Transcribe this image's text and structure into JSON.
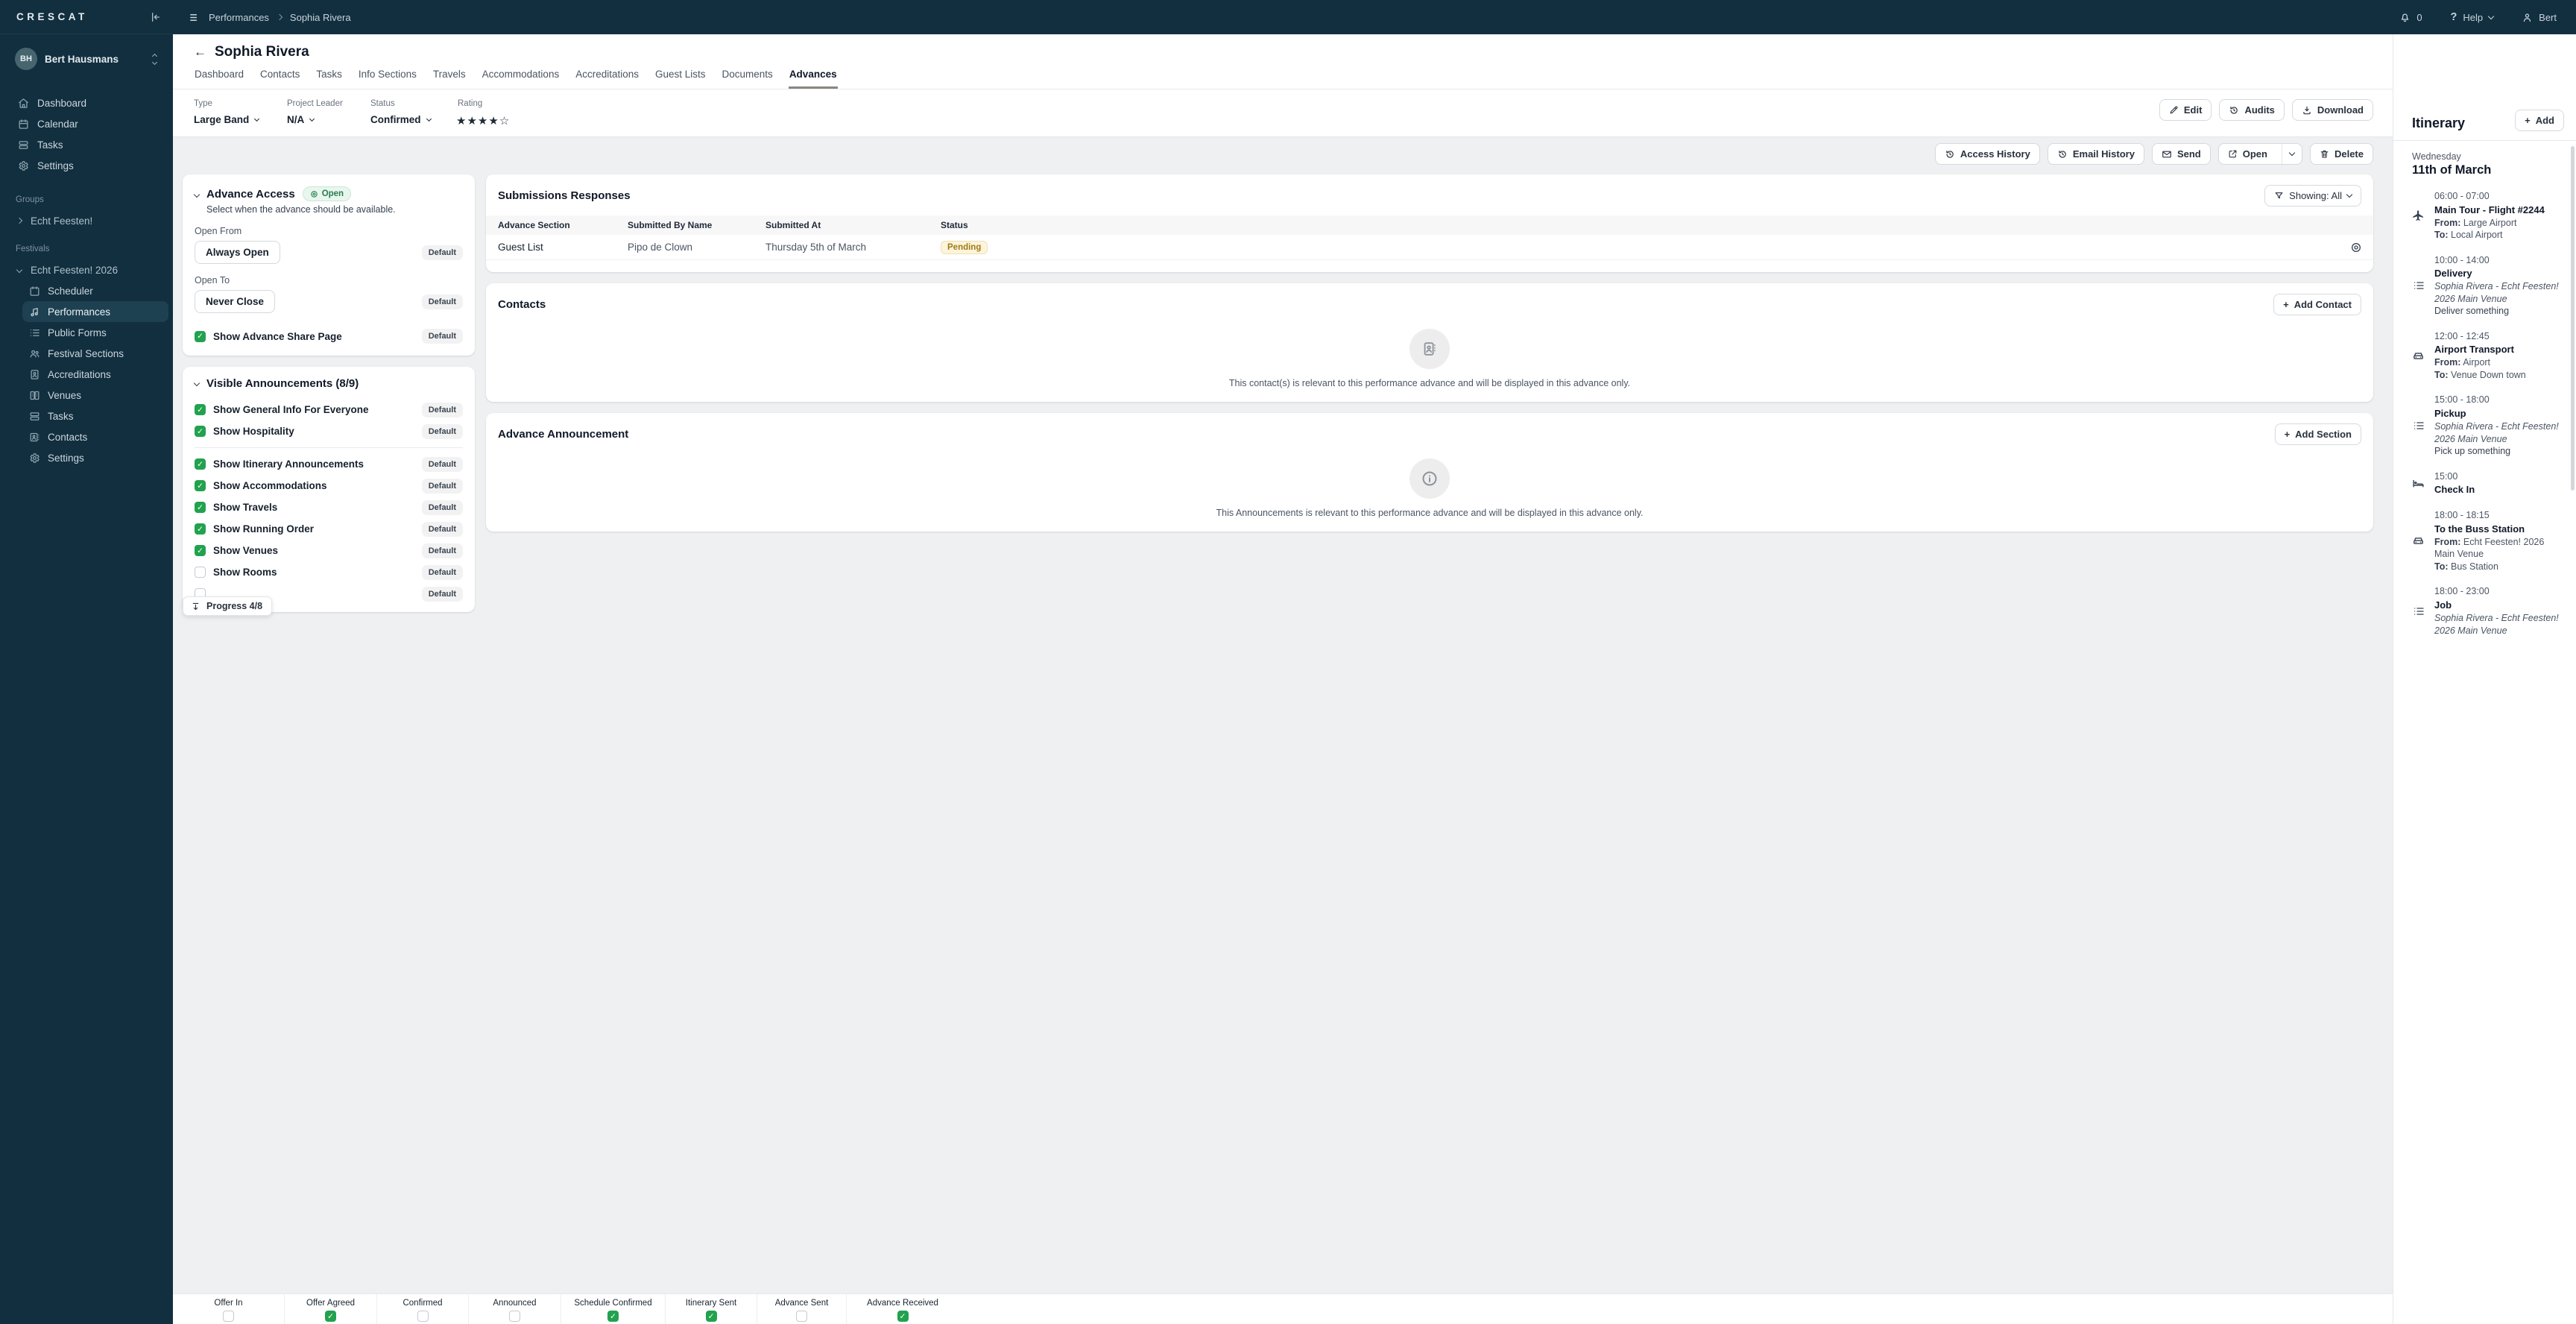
{
  "brand": {
    "logo": "CRESCAT"
  },
  "topbar": {
    "breadcrumb": {
      "section": "Performances",
      "current": "Sophia Rivera"
    },
    "notification_count": "0",
    "help_label": "Help",
    "user_label": "Bert"
  },
  "sidebar": {
    "user": {
      "initials": "BH",
      "name": "Bert Hausmans"
    },
    "nav": [
      {
        "label": "Dashboard",
        "icon": "home-icon"
      },
      {
        "label": "Calendar",
        "icon": "calendar-icon"
      },
      {
        "label": "Tasks",
        "icon": "tasks-icon"
      },
      {
        "label": "Settings",
        "icon": "gear-icon"
      }
    ],
    "groups_label": "Groups",
    "group_item": "Echt Feesten!",
    "festivals_label": "Festivals",
    "festival_item": "Echt Feesten! 2026",
    "festival_nav": [
      {
        "label": "Scheduler",
        "icon": "calendar-icon",
        "active": false
      },
      {
        "label": "Performances",
        "icon": "music-note-icon",
        "active": true
      },
      {
        "label": "Public Forms",
        "icon": "list-icon",
        "active": false
      },
      {
        "label": "Festival Sections",
        "icon": "users-icon",
        "active": false
      },
      {
        "label": "Accreditations",
        "icon": "id-card-icon",
        "active": false
      },
      {
        "label": "Venues",
        "icon": "venues-icon",
        "active": false
      },
      {
        "label": "Tasks",
        "icon": "tasks-icon",
        "active": false
      },
      {
        "label": "Contacts",
        "icon": "contact-card-icon",
        "active": false
      },
      {
        "label": "Settings",
        "icon": "gear-icon",
        "active": false
      }
    ]
  },
  "page": {
    "title": "Sophia Rivera",
    "tabs": [
      "Dashboard",
      "Contacts",
      "Tasks",
      "Info Sections",
      "Travels",
      "Accommodations",
      "Accreditations",
      "Guest Lists",
      "Documents",
      "Advances"
    ],
    "active_tab": "Advances"
  },
  "meta": {
    "type": {
      "label": "Type",
      "value": "Large Band"
    },
    "project_leader": {
      "label": "Project Leader",
      "value": "N/A"
    },
    "status": {
      "label": "Status",
      "value": "Confirmed"
    },
    "rating": {
      "label": "Rating",
      "stars_filled": 4,
      "stars_total": 5
    }
  },
  "header_actions": {
    "edit": "Edit",
    "audits": "Audits",
    "download": "Download"
  },
  "toolbar": {
    "access_history": "Access History",
    "email_history": "Email History",
    "send": "Send",
    "open": "Open",
    "delete": "Delete"
  },
  "advance_access": {
    "title": "Advance Access",
    "badge": "Open",
    "description": "Select when the advance should be available.",
    "open_from_label": "Open From",
    "open_from_value": "Always Open",
    "open_to_label": "Open To",
    "open_to_value": "Never Close",
    "share_label": "Show Advance Share Page",
    "share_checked": true,
    "default_badge": "Default"
  },
  "announcements": {
    "title": "Visible Announcements (8/9)",
    "default_badge": "Default",
    "items": [
      {
        "label": "Show General Info For Everyone",
        "checked": true
      },
      {
        "label": "Show Hospitality",
        "checked": true
      },
      {
        "label": "Show Itinerary Announcements",
        "checked": true
      },
      {
        "label": "Show Accommodations",
        "checked": true
      },
      {
        "label": "Show Travels",
        "checked": true
      },
      {
        "label": "Show Running Order",
        "checked": true
      },
      {
        "label": "Show Venues",
        "checked": true
      },
      {
        "label": "Show Rooms",
        "checked": false
      }
    ]
  },
  "submissions": {
    "title": "Submissions Responses",
    "filter_label": "Showing: All",
    "columns": [
      "Advance Section",
      "Submitted By Name",
      "Submitted At",
      "Status"
    ],
    "rows": [
      {
        "section": "Guest List",
        "submitted_by": "Pipo de Clown",
        "submitted_at": "Thursday 5th of March",
        "status": "Pending"
      }
    ]
  },
  "contacts_card": {
    "title": "Contacts",
    "add_label": "Add Contact",
    "empty_text": "This contact(s) is relevant to this performance advance and will be displayed in this advance only."
  },
  "announcement_card": {
    "title": "Advance Announcement",
    "add_label": "Add Section",
    "empty_text": "This Announcements is relevant to this performance advance and will be displayed in this advance only."
  },
  "itinerary": {
    "title": "Itinerary",
    "add_label": "Add",
    "day_weekday": "Wednesday",
    "day_date": "11th of March",
    "from_label": "From:",
    "to_label": "To:",
    "events": [
      {
        "time": "06:00 - 07:00",
        "icon": "plane-icon",
        "title": "Main Tour - Flight #2244",
        "from": "Large Airport",
        "to": "Local Airport"
      },
      {
        "time": "10:00 - 14:00",
        "icon": "list-icon",
        "title": "Delivery",
        "venue": "Sophia Rivera - Echt Feesten! 2026 Main Venue",
        "note": "Deliver something"
      },
      {
        "time": "12:00 - 12:45",
        "icon": "car-icon",
        "title": "Airport Transport",
        "from": "Airport",
        "to": "Venue Down town"
      },
      {
        "time": "15:00 - 18:00",
        "icon": "list-icon",
        "title": "Pickup",
        "venue": "Sophia Rivera - Echt Feesten! 2026 Main Venue",
        "note": "Pick up something"
      },
      {
        "time": "15:00",
        "icon": "bed-icon",
        "title": "Check In"
      },
      {
        "time": "18:00 - 18:15",
        "icon": "car-icon",
        "title": "To the Buss Station",
        "from": "Echt Feesten! 2026 Main Venue",
        "to": "Bus Station"
      },
      {
        "time": "18:00 - 23:00",
        "icon": "list-icon",
        "title": "Job",
        "venue": "Sophia Rivera - Echt Feesten! 2026 Main Venue"
      }
    ]
  },
  "progress_pill": "Progress 4/8",
  "status_bar": [
    {
      "label": "Offer In",
      "checked": false
    },
    {
      "label": "Offer Agreed",
      "checked": true
    },
    {
      "label": "Confirmed",
      "checked": false
    },
    {
      "label": "Announced",
      "checked": false
    },
    {
      "label": "Schedule Confirmed",
      "checked": true
    },
    {
      "label": "Itinerary Sent",
      "checked": true
    },
    {
      "label": "Advance Sent",
      "checked": false
    },
    {
      "label": "Advance Received",
      "checked": true
    }
  ],
  "colors": {
    "sidebar_bg": "#122F3F",
    "active_item_bg": "#1E4152",
    "accent_green": "#22A24E",
    "pending_bg": "#FCF4DB",
    "pending_text": "#A07B17",
    "tab_underline": "#8B8680",
    "page_bg": "#EEF0F1"
  }
}
